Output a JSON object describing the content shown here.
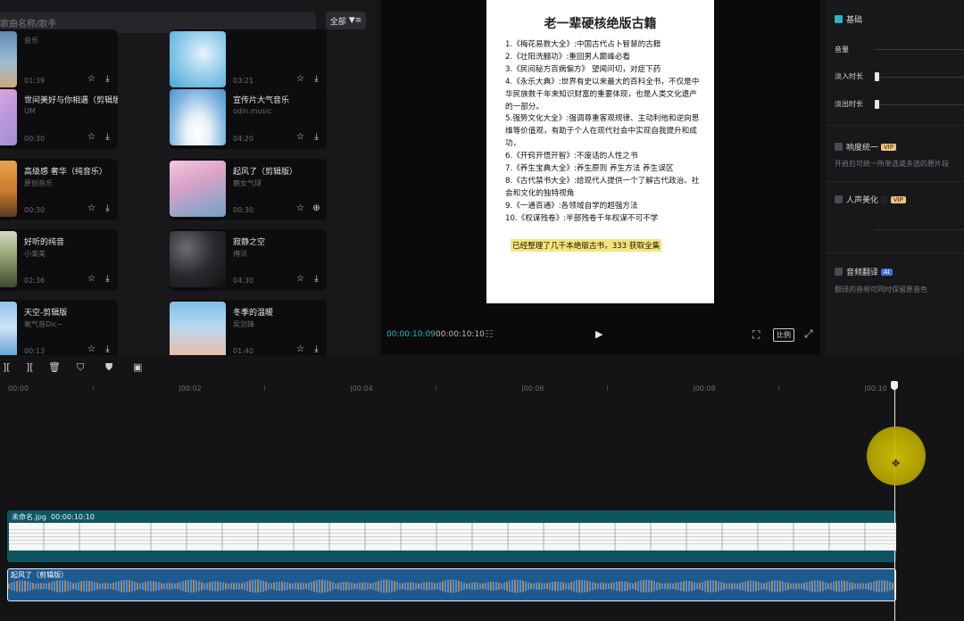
{
  "library": {
    "search_placeholder": "歌曲名称/歌手",
    "filter_label": "全部",
    "cards": [
      {
        "title": "",
        "subtitle": "音乐",
        "duration": "01:39"
      },
      {
        "title": "",
        "subtitle": "",
        "duration": "03:21"
      },
      {
        "title": "世间美好与你相遇（剪辑版4）",
        "subtitle": "UM",
        "duration": "00:30"
      },
      {
        "title": "宣传片大气音乐",
        "subtitle": "odin.music",
        "duration": "04:20"
      },
      {
        "title": "高级感 奢华（纯音乐）",
        "subtitle": "原创音乐",
        "duration": "00:30"
      },
      {
        "title": "起风了（剪辑版）",
        "subtitle": "鹿女气球",
        "duration": "00:30"
      },
      {
        "title": "好听的纯音",
        "subtitle": "小楽美",
        "duration": "02:36"
      },
      {
        "title": "寂静之空",
        "subtitle": "傅浒",
        "duration": "04:30"
      },
      {
        "title": "天空-剪辑版",
        "subtitle": "氧气音Dic~",
        "duration": "00:13"
      },
      {
        "title": "冬季的温暖",
        "subtitle": "吴剑锋",
        "duration": "01:40"
      }
    ]
  },
  "preview": {
    "doc_title": "老一辈硬核绝版古籍",
    "doc_lines": [
      "1.《梅花易数大全》:中国古代占卜智慧的古籍",
      "2.《壮阳洗髓功》:重回男人巅峰必看",
      "3.《民间秘方百病偏方》 望闻问切，对症下药",
      "4.《永乐大典》:世界有史以来最大的百科全书，不仅是中华民族数千年来知识财富的重要体现，也是人类文化遗产的一部分。",
      "5.强势文化大全》:强调尊重客观规律、主动利他和逆向思维等价值观，有助于个人在现代社会中实现自我提升和成功，",
      "6.《开窍开悟开智》:不废话的人性之书",
      "7.《养生宝典大全》:养生原则 养生方法 养生误区",
      "8.《古代禁书大全》:给现代人提供一个了解古代政治、社会和文化的独特视角",
      "9.《一通百通》:各领域自学的超强方法",
      "10.《权谋残卷》:半部残卷千年权谋不可不学"
    ],
    "doc_highlight": "已经整理了几千本绝版古书，333 获取全集",
    "timecode_current": "00:00:10:09",
    "timecode_total": "00:00:10:10",
    "ratio_label": "比例"
  },
  "props": {
    "basic_label": "基础",
    "volume_label": "音量",
    "fade_in_label": "淡入时长",
    "fade_out_label": "淡出时长",
    "loudness_label": "响度统一",
    "loudness_desc": "开启后可统一所单选或多选的原片段",
    "voice_label": "人声美化",
    "translate_label": "音频翻译",
    "translate_desc": "翻译的音频可同时保留原音色",
    "vip_badge": "VIP",
    "ai_badge": "AI",
    "volume_level": 0.0,
    "fade_in_level": 0.0,
    "fade_out_level": 0.0
  },
  "timeline": {
    "ruler_labels": [
      "00:00",
      "|00:02",
      "|00:04",
      "|00:06",
      "|00:08",
      "|00:10"
    ],
    "video_clip_name": "未命名.jpg",
    "video_clip_duration": "00:00:10:10",
    "audio_clip_name": "起风了（剪辑版）"
  },
  "colors": {
    "accent_cyan": "#2fb3c9",
    "audio_track": "#1f5a8f",
    "video_track": "#0f5560",
    "highlight": "#f6e47a",
    "cursor_halo": "#d6c400"
  }
}
